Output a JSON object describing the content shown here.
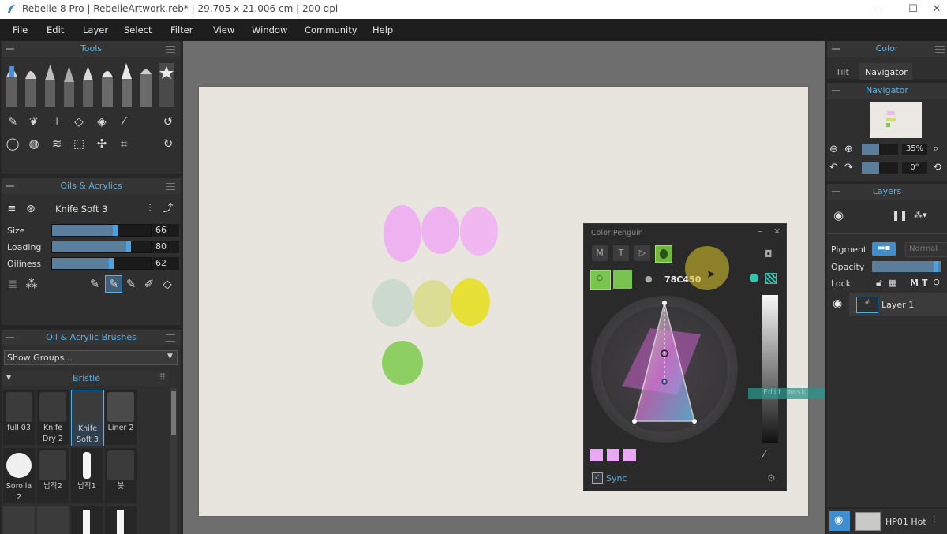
{
  "window": {
    "title": "Rebelle 8 Pro | RebelleArtwork.reb* | 29.705 x 21.006 cm | 200 dpi",
    "minimize": "—",
    "maximize": "☐",
    "close": "✕"
  },
  "menu": [
    "File",
    "Edit",
    "Layer",
    "Select",
    "Filter",
    "View",
    "Window",
    "Community",
    "Help"
  ],
  "tools_panel": {
    "title": "Tools"
  },
  "oils_panel": {
    "title": "Oils & Acrylics",
    "brush_name": "Knife Soft 3",
    "sliders": [
      {
        "label": "Size",
        "value": "66",
        "fraction": 0.66
      },
      {
        "label": "Loading",
        "value": "80",
        "fraction": 0.8
      },
      {
        "label": "Oiliness",
        "value": "62",
        "fraction": 0.62
      }
    ]
  },
  "brushes_panel": {
    "title": "Oil & Acrylic Brushes",
    "groups_select": "Show Groups...",
    "category": "Bristle",
    "brushes_row1": [
      {
        "label": "full 03"
      },
      {
        "label": "Knife Dry 2"
      },
      {
        "label": "Knife Soft 3"
      },
      {
        "label": "Liner 2"
      }
    ],
    "brushes_row2": [
      {
        "label": "Sorolla 2"
      },
      {
        "label": "납작2"
      },
      {
        "label": "납작1"
      },
      {
        "label": "붓"
      }
    ]
  },
  "color_penguin": {
    "title": "Color Penguin",
    "tabs": [
      "M",
      "T",
      "▷"
    ],
    "hex": "78C450",
    "sync_label": "Sync",
    "sync_checked": true,
    "swatches": [
      "#e9a8f2",
      "#e9a8f2",
      "#e9a8f2"
    ],
    "current_color": "#78c450"
  },
  "tooltip": {
    "text": "Edit mask"
  },
  "right": {
    "color_title": "Color",
    "tabs": [
      "Tilt",
      "Navigator"
    ],
    "navigator_title": "Navigator",
    "zoom": "35%",
    "rotation": "0°",
    "layers_title": "Layers",
    "pigment_label": "Pigment",
    "blend_mode": "Normal",
    "opacity_label": "Opacity",
    "lock_label": "Lock",
    "lock_letters": [
      "M",
      "T"
    ],
    "layer_name": "Layer 1",
    "paper_name": "HP01 Hot"
  }
}
